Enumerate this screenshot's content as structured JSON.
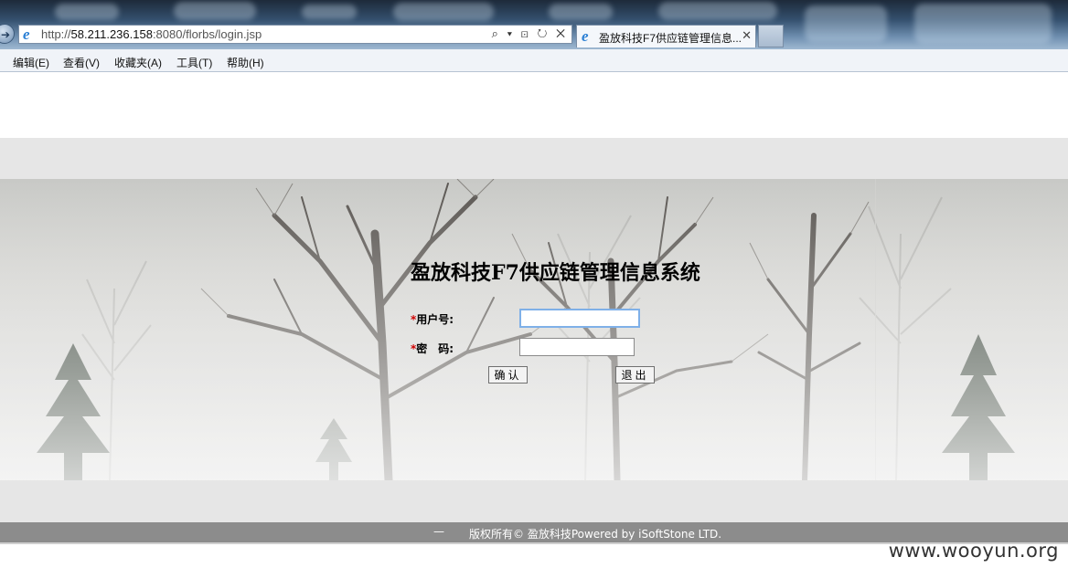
{
  "browser": {
    "url_prefix": "http://",
    "url_host": "58.211.236.158",
    "url_rest": ":8080/florbs/login.jsp",
    "address_tools": "⌕ ▾ ⊡ ↻ ✕",
    "tab_title": "盈放科技F7供应链管理信息...",
    "tab_close": "✕",
    "back_glyph": "➔",
    "ie_glyph": "e"
  },
  "menu": {
    "items": [
      "编辑(E)",
      "查看(V)",
      "收藏夹(A)",
      "工具(T)",
      "帮助(H)"
    ]
  },
  "login": {
    "title": "盈放科技F7供应链管理信息系统",
    "required_mark": "*",
    "username_label": "用户号:",
    "password_label": "密　码:",
    "username_value": "",
    "password_value": "",
    "confirm_button": "确认",
    "exit_button": "退出"
  },
  "footer": {
    "dash": "—",
    "text": "版权所有© 盈放科技Powered by iSoftStone LTD."
  },
  "watermark": "www.wooyun.org"
}
